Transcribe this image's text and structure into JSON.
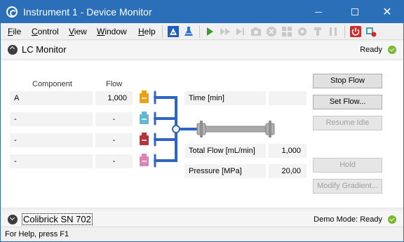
{
  "window": {
    "title": "Instrument 1 - Device Monitor",
    "controls": {
      "minimize": "—",
      "maximize": "☐",
      "close": "✕"
    }
  },
  "menu": {
    "items": [
      {
        "label": "File",
        "key": "F",
        "rest": "ile"
      },
      {
        "label": "Control",
        "key": "C",
        "rest": "ontrol"
      },
      {
        "label": "View",
        "key": "V",
        "rest": "iew"
      },
      {
        "label": "Window",
        "key": "W",
        "rest": "indow"
      },
      {
        "label": "Help",
        "key": "H",
        "rest": "elp"
      }
    ],
    "toolbar_icons": [
      "method-icon",
      "flask-icon",
      "play-icon",
      "fast-forward-icon",
      "skip-forward-icon",
      "step-icon",
      "camera-icon",
      "stop-icon",
      "grid-icon",
      "settings-icon",
      "nozzle-icon",
      "pause-icon",
      "power-icon",
      "network-icon"
    ]
  },
  "lc_monitor": {
    "title": "LC Monitor",
    "status": "Ready",
    "columns": {
      "component": "Component",
      "flow": "Flow"
    },
    "rows": [
      {
        "component": "A",
        "flow": "1,000",
        "bottle_color": "#f0a20e"
      },
      {
        "component": "-",
        "flow": "-",
        "bottle_color": "#60b9d0"
      },
      {
        "component": "-",
        "flow": "-",
        "bottle_color": "#b8323a"
      },
      {
        "component": "-",
        "flow": "-",
        "bottle_color": "#dd84b4"
      }
    ],
    "readouts": {
      "time_label": "Time [min]",
      "time_value": "",
      "total_flow_label": "Total Flow [mL/min]",
      "total_flow_value": "1,000",
      "pressure_label": "Pressure [MPa]",
      "pressure_value": "20,00"
    },
    "buttons": {
      "stop_flow": "Stop Flow",
      "set_flow": "Set Flow...",
      "resume_idle": "Resume Idle",
      "hold": "Hold",
      "modify_gradient": "Modify Gradient..."
    }
  },
  "colibrick": {
    "title": "Colibrick SN 702",
    "status": "Demo Mode: Ready"
  },
  "statusbar": {
    "text": "For Help, press F1"
  },
  "colors": {
    "titlebar": "#2b6fb9",
    "pipe": "#2f64c4",
    "ready_green": "#7cb82f"
  }
}
